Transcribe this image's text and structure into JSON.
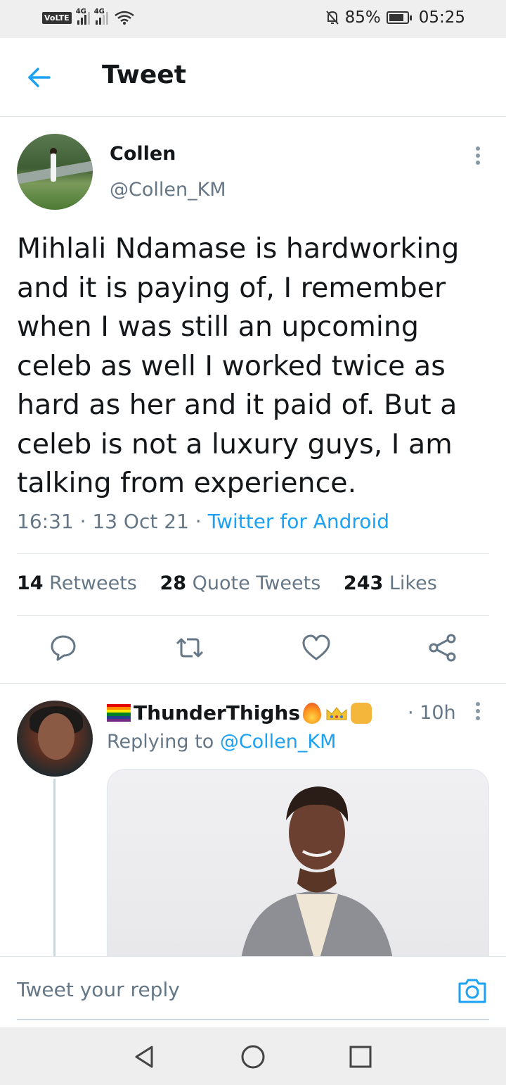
{
  "status_bar": {
    "carrier_badge": "VoLTE",
    "net1": "4G",
    "net2": "4G",
    "battery": "85%",
    "battery_level": 0.85,
    "time": "05:25",
    "icons": [
      "volte-icon",
      "signal-icon",
      "wifi-icon",
      "mute-icon",
      "battery-icon"
    ]
  },
  "header": {
    "title": "Tweet"
  },
  "tweet": {
    "author_name": "Collen",
    "author_handle": "@Collen_KM",
    "text": "Mihlali Ndamase is hardworking and it is paying of, I remember when I was still an upcoming celeb as well I worked twice as hard as her and it paid of. But a celeb is not a luxury guys, I am talking from experience.",
    "time": "16:31",
    "date": "13 Oct 21",
    "source": "Twitter for Android",
    "retweets_count": "14",
    "retweets_label": "Retweets",
    "quotes_count": "28",
    "quotes_label": "Quote Tweets",
    "likes_count": "243",
    "likes_label": "Likes"
  },
  "reply": {
    "author_name": "ThunderThighs",
    "time": "10h",
    "replying_prefix": "Replying to",
    "replying_to": "@Collen_KM"
  },
  "composer": {
    "placeholder": "Tweet your reply"
  },
  "colors": {
    "accent": "#1da1f2",
    "secondary_text": "#657786",
    "divider": "#e1e8ed"
  }
}
